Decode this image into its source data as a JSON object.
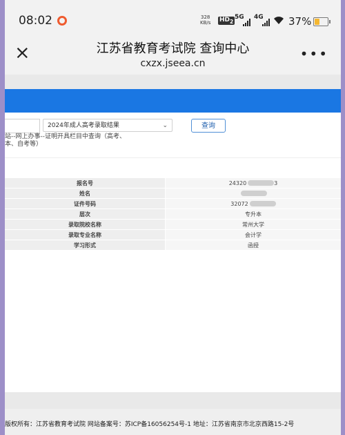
{
  "status_bar": {
    "time": "08:02",
    "net_speed_value": "328",
    "net_speed_unit": "KB/s",
    "hd_badge": "HD",
    "hd_sub": "2",
    "signal_1_label": "5G",
    "signal_2_label": "4G",
    "battery_percent": "37%",
    "battery_level": 0.37,
    "icons": [
      "record-icon",
      "wifi-icon",
      "battery-icon"
    ]
  },
  "header": {
    "title": "江苏省教育考试院 查询中心",
    "url": "cxzx.jseea.cn",
    "close_glyph": "×",
    "more_glyph": "•••"
  },
  "query": {
    "selected_option": "2024年成人高考录取结果",
    "button_label": "查询"
  },
  "breadcrumb": {
    "line1": "站--网上办事--证明开具栏目中查询（高考、",
    "line2": "本、自考等）"
  },
  "results": [
    {
      "label": "报名号",
      "value": "24320",
      "tail": "3",
      "masked": true
    },
    {
      "label": "姓名",
      "value": "",
      "tail": "",
      "masked": true
    },
    {
      "label": "证件号码",
      "value": "32072",
      "tail": "",
      "masked": true
    },
    {
      "label": "层次",
      "value": "专升本",
      "tail": "",
      "masked": false
    },
    {
      "label": "录取院校名称",
      "value": "常州大学",
      "tail": "",
      "masked": false
    },
    {
      "label": "录取专业名称",
      "value": "会计学",
      "tail": "",
      "masked": false
    },
    {
      "label": "学习形式",
      "value": "函授",
      "tail": "",
      "masked": false
    }
  ],
  "footer": {
    "text": "版权所有：江苏省教育考试院 网站备案号：苏ICP备16056254号-1 地址：江苏省南京市北京西路15-2号"
  },
  "colors": {
    "accent_blue": "#1a77e3",
    "background_frame": "#9d8fc8"
  }
}
